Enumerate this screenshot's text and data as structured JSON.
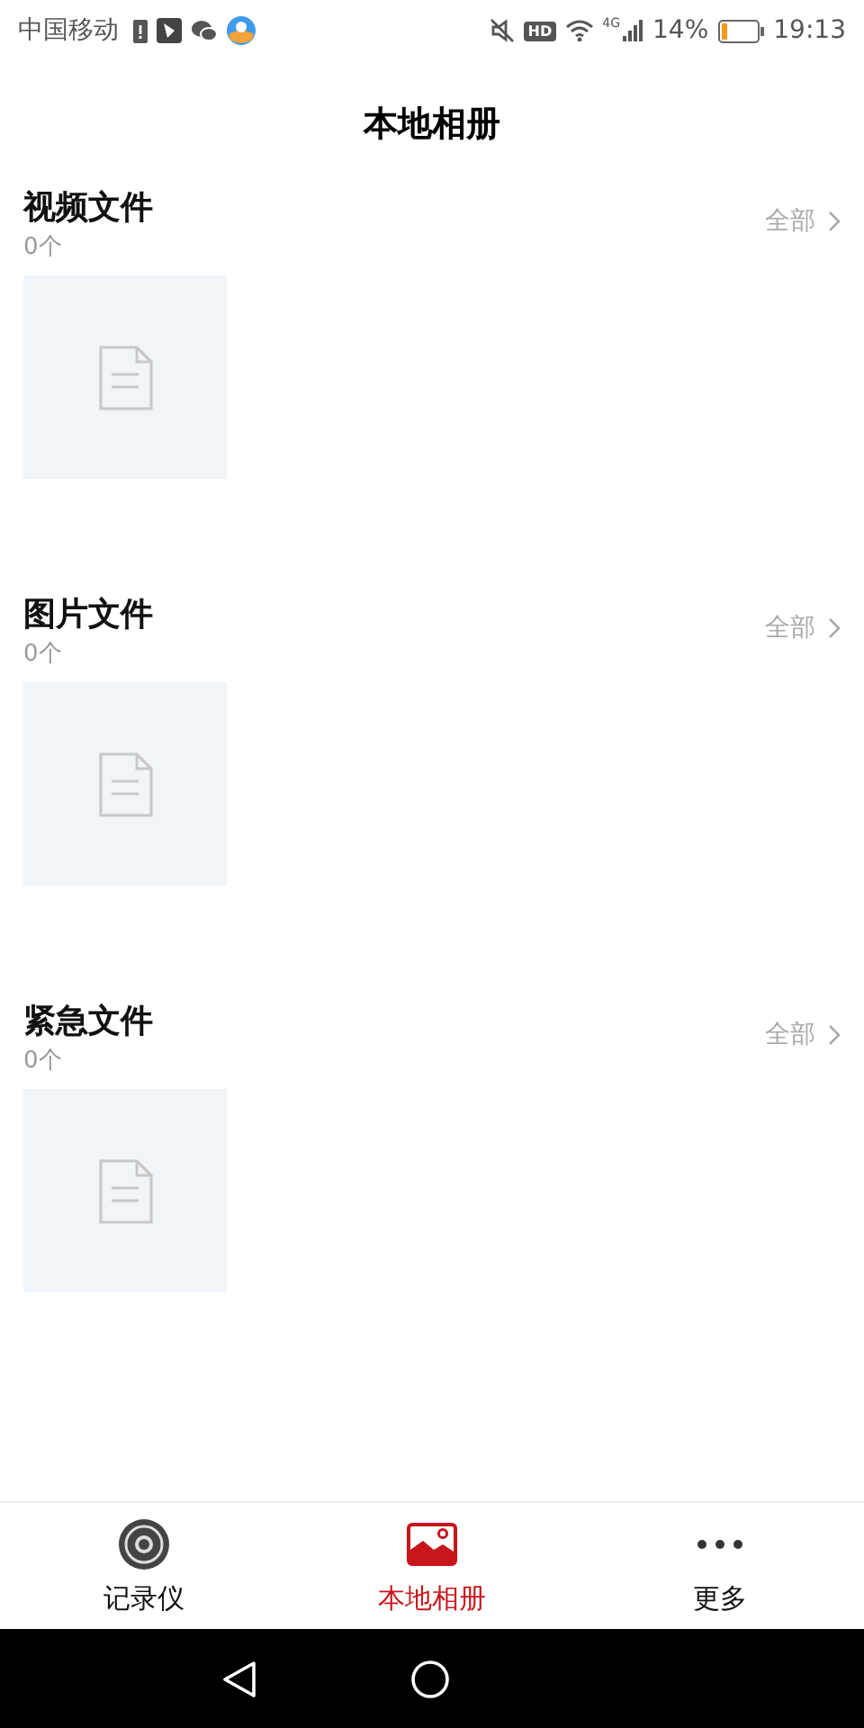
{
  "status_bar": {
    "carrier": "中国移动",
    "hd": "HD",
    "network": "4G",
    "battery": "14%",
    "time": "19:13"
  },
  "title": "本地相册",
  "sections": [
    {
      "title": "视频文件",
      "count": "0个",
      "more": "全部"
    },
    {
      "title": "图片文件",
      "count": "0个",
      "more": "全部"
    },
    {
      "title": "紧急文件",
      "count": "0个",
      "more": "全部"
    }
  ],
  "tabs": [
    {
      "label": "记录仪",
      "kind": "recorder",
      "selected": false
    },
    {
      "label": "本地相册",
      "kind": "album",
      "selected": true
    },
    {
      "label": "更多",
      "kind": "more",
      "selected": false
    }
  ]
}
